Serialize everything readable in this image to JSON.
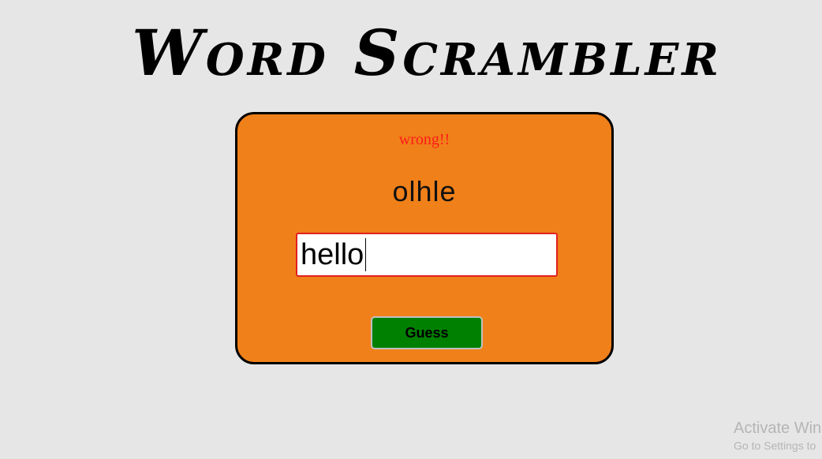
{
  "app": {
    "title": "Word Scrambler"
  },
  "game": {
    "message": "wrong!!",
    "scrambled_word": "olhle",
    "input_value": "hello",
    "guess_button_label": "Guess"
  },
  "watermark": {
    "line1": "Activate Win",
    "line2": "Go to Settings to"
  },
  "colors": {
    "background": "#e6e6e6",
    "card": "#f08019",
    "message": "#ff1a1a",
    "button": "#008000",
    "input_border": "#e02020"
  }
}
